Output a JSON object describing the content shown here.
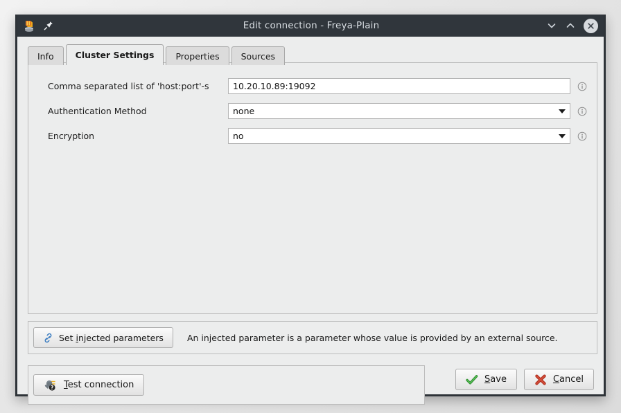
{
  "window": {
    "title": "Edit connection - Freya-Plain",
    "app_icon": "database-stack-icon",
    "pin_icon": "pin-icon",
    "controls": {
      "minimize": "chevron-down-icon",
      "maximize": "chevron-up-icon",
      "close": "close-circle-icon"
    }
  },
  "tabs": [
    {
      "label": "Info",
      "active": false
    },
    {
      "label": "Cluster Settings",
      "active": true
    },
    {
      "label": "Properties",
      "active": false
    },
    {
      "label": "Sources",
      "active": false
    }
  ],
  "form": {
    "rows": [
      {
        "label": "Comma separated list of 'host:port'-s",
        "value": "10.20.10.89:19092",
        "type": "text",
        "info_icon": "info-icon"
      },
      {
        "label": "Authentication Method",
        "value": "none",
        "type": "combo",
        "info_icon": "info-icon"
      },
      {
        "label": "Encryption",
        "value": "no",
        "type": "combo",
        "info_icon": "info-icon"
      }
    ]
  },
  "injected": {
    "button_label_pre": "Set ",
    "button_label_mnemonic": "i",
    "button_label_post": "njected parameters",
    "button_icon": "link-chain-icon",
    "note": "An injected parameter is a parameter whose value is provided by an external source."
  },
  "test": {
    "button_label_mnemonic": "T",
    "button_label_post": "est connection",
    "button_icon": "plug-question-icon"
  },
  "actions": {
    "save": {
      "label_mnemonic": "S",
      "label_post": "ave",
      "icon": "check-icon",
      "color": "#3a9b3a"
    },
    "cancel": {
      "label_mnemonic": "C",
      "label_post": "ancel",
      "icon": "cross-icon",
      "color": "#c0392b"
    }
  },
  "colors": {
    "titlebar": "#30363c",
    "panel": "#eceded",
    "border": "#bcbcbc",
    "field_bg": "#ffffff",
    "accent_link": "#3a7cc0"
  }
}
